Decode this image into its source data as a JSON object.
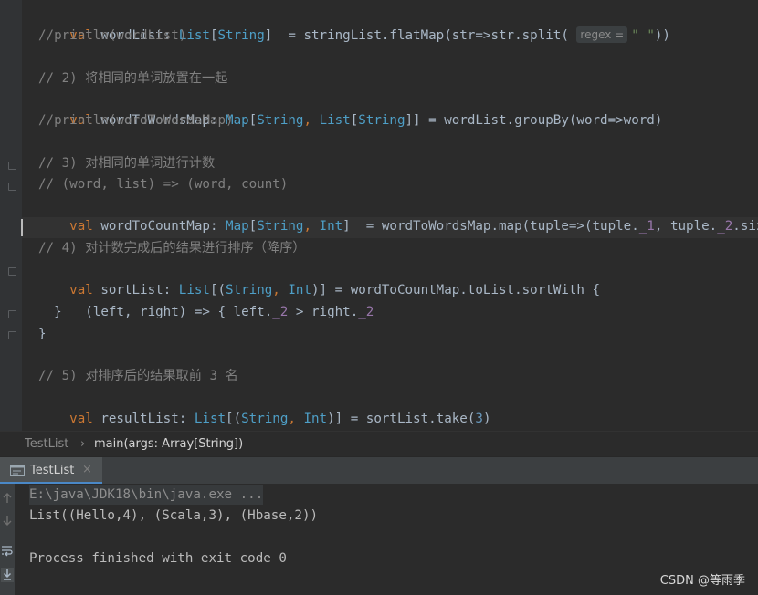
{
  "editor": {
    "line_top": {
      "p1": "val",
      "p2": "wordList",
      "p3": ": ",
      "p4": "List",
      "p5": "[",
      "p6": "String",
      "p7": "]  = stringList.flatMap(str=>str.split(",
      "hint": "regex =",
      "str": "\" \"",
      "p8": "))"
    },
    "line_print1": "//println(wordList)",
    "comment2": "// 2) 将相同的单词放置在一起",
    "line_map": {
      "p1": "val",
      "p2": "wordToWordsMap",
      "p3": ": ",
      "p4": "Map",
      "p5": "[",
      "p6": "String",
      "p7": ", ",
      "p8": "List",
      "p9": "[",
      "p10": "String",
      "p11": "]] = wordList.groupBy(word=>word)"
    },
    "line_print2": "//println(wordToWordsMap)",
    "comment3": "// 3) 对相同的单词进行计数",
    "comment3b": "// (word, list) => (word, count)",
    "line_count": {
      "p1": "val",
      "p2": "wordToCountMap",
      "p3": ": ",
      "p4": "Map",
      "p5": "[",
      "p6": "String",
      "p7": ", ",
      "p8": "Int",
      "p9": "]  = wordToWordsMap.map(tuple=>(tuple.",
      "p10": "_1",
      "p11": ", tuple.",
      "p12": "_2",
      "p13": ".siz"
    },
    "comment4": "// 4) 对计数完成后的结果进行排序（降序）",
    "line_sort": {
      "p1": "val",
      "p2": "sortList",
      "p3": ": ",
      "p4": "List",
      "p5": "[(",
      "p6": "String",
      "p7": ", ",
      "p8": "Int",
      "p9": ")] = wordToCountMap.toList.sortWith {"
    },
    "line_lambda": {
      "p1": "  (left, right) => { left.",
      "p2": "_2",
      "p3": " > right.",
      "p4": "_2"
    },
    "line_brace1": "  }",
    "line_brace2": "}",
    "comment5": "// 5) 对排序后的结果取前 3 名",
    "line_result": {
      "p1": "val",
      "p2": "resultList",
      "p3": ": ",
      "p4": "List",
      "p5": "[(",
      "p6": "String",
      "p7": ", ",
      "p8": "Int",
      "p9": ")] = sortList.take(",
      "p10": "3",
      "p11": ")"
    }
  },
  "breadcrumb": {
    "file": "TestList",
    "separator": "›",
    "method": "main(args: Array[String])"
  },
  "run_panel": {
    "tab_label": "TestList",
    "close_glyph": "×"
  },
  "console": {
    "command": "E:\\java\\JDK18\\bin\\java.exe ...",
    "output": "List((Hello,4), (Scala,3), (Hbase,2))",
    "exit": "Process finished with exit code 0"
  },
  "watermark": "CSDN @等雨季",
  "colors": {
    "keyword": "#cc7832",
    "type": "#4e9fc7",
    "comment": "#808080",
    "number": "#6897bb",
    "string": "#6a8759",
    "field": "#9876aa",
    "accent": "#4a88c7"
  }
}
